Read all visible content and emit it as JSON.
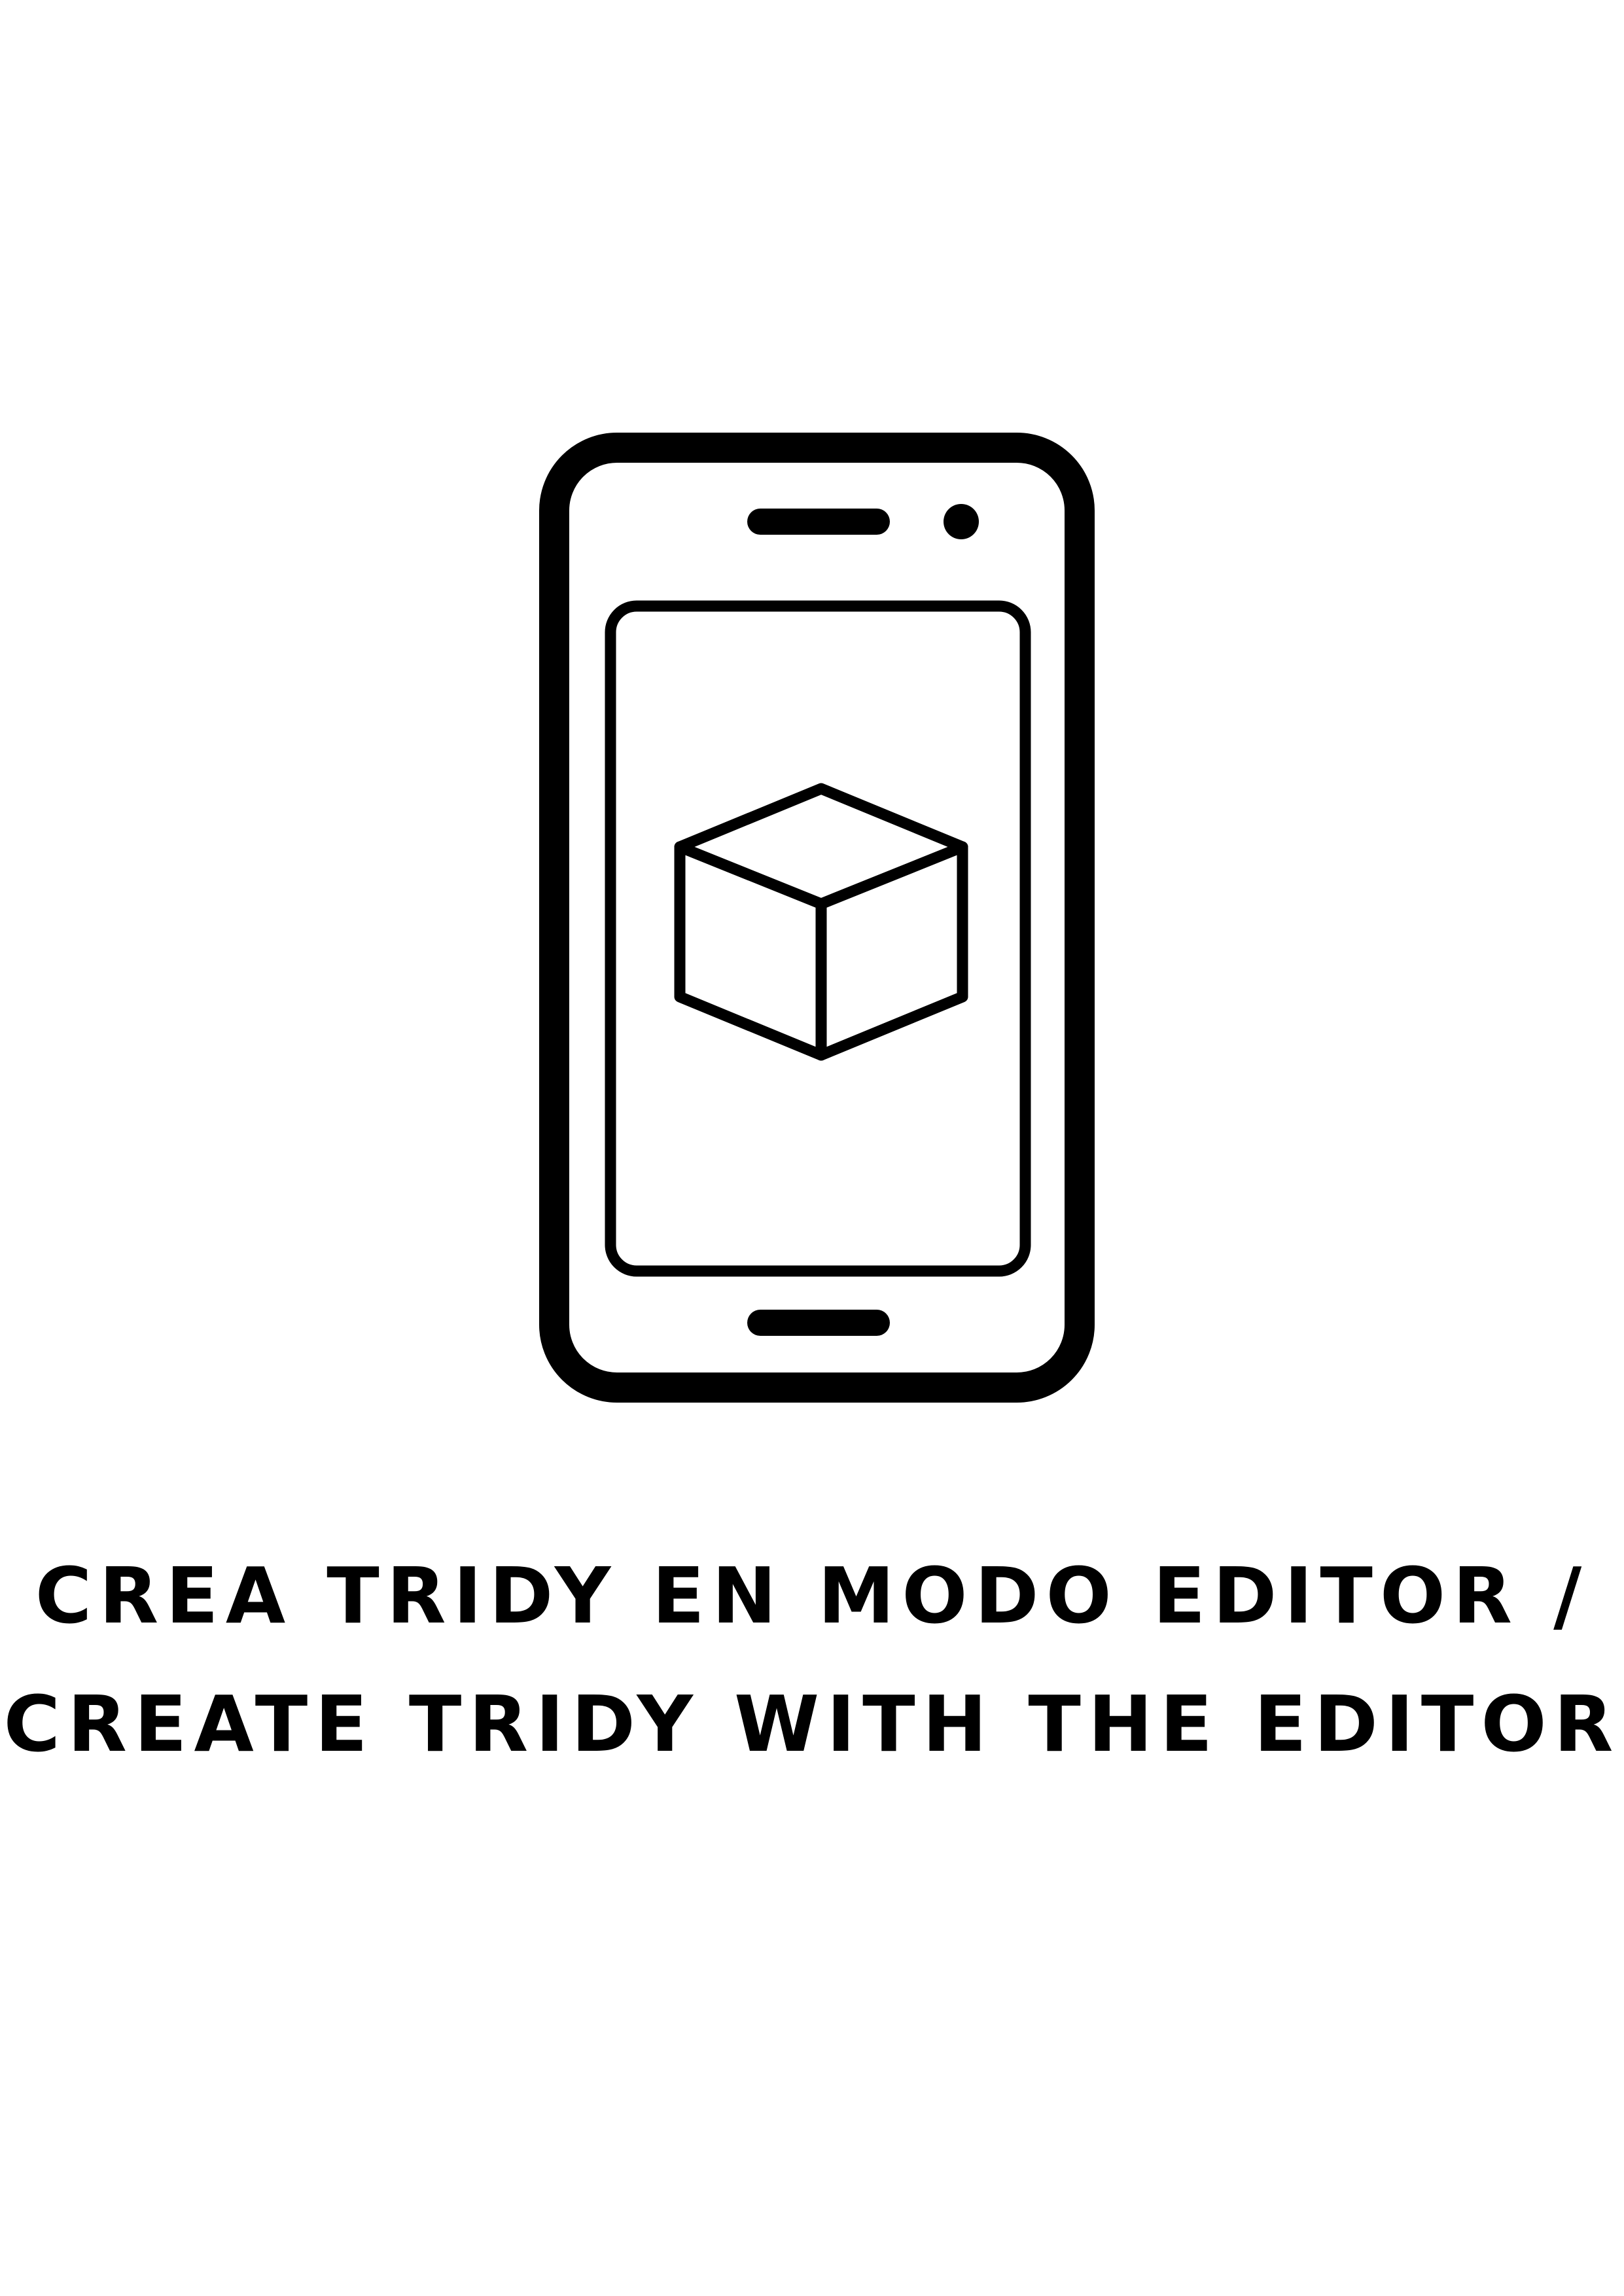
{
  "illustration": {
    "device_icon": "smartphone-icon",
    "screen_icon": "cube-icon",
    "stroke_color": "#000000"
  },
  "caption": {
    "line1": "CREA TRIDY EN MODO EDITOR /",
    "line2": "CREATE TRIDY WITH THE EDITOR"
  }
}
